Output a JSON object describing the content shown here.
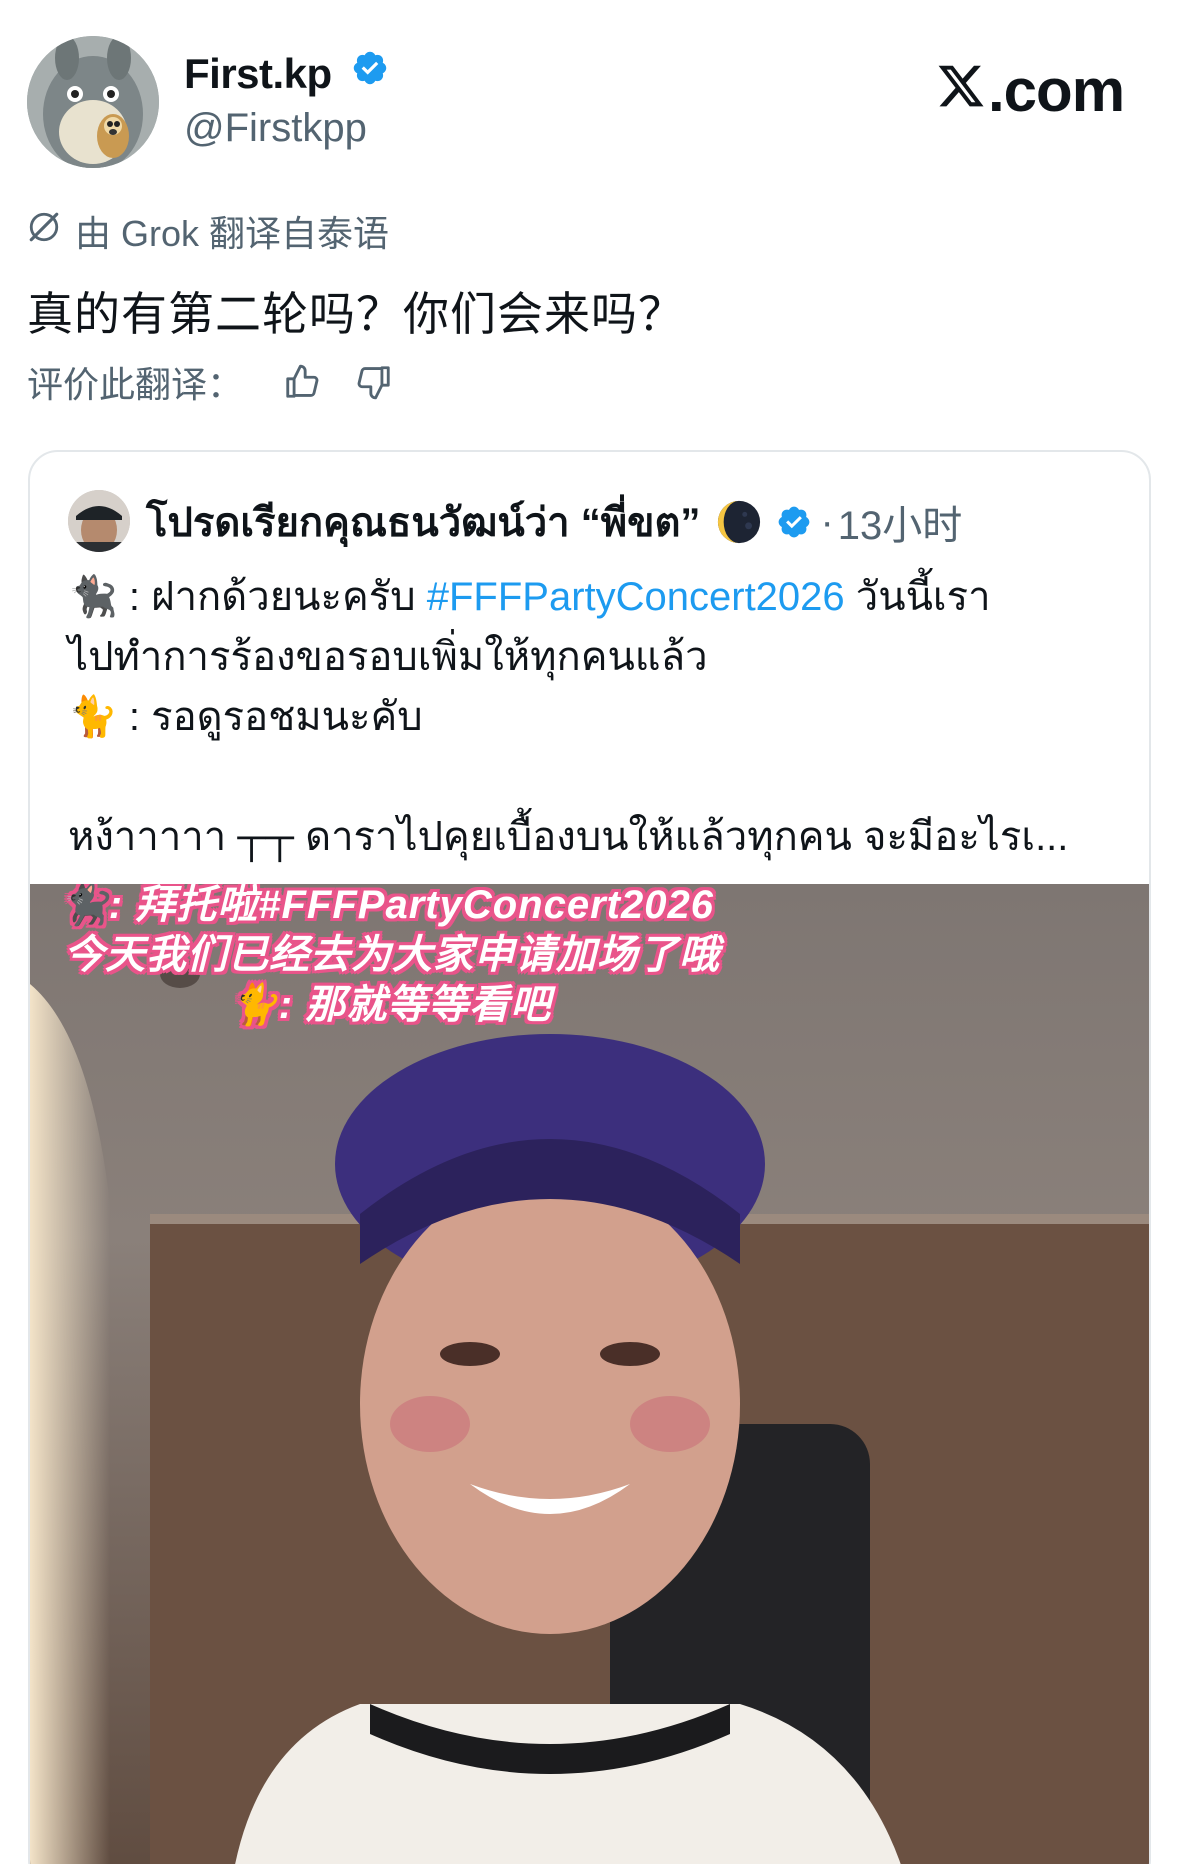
{
  "author": {
    "display_name": "First.kp",
    "handle": "@Firstkpp",
    "verified": true
  },
  "brand": {
    "site": ".com"
  },
  "translation": {
    "label": "由 Grok 翻译自泰语",
    "text": "真的有第二轮吗？你们会来吗？",
    "rate_label": "评价此翻译："
  },
  "quoted": {
    "display_name": "โปรดเรียกคุณธนวัฒน์ว่า “พี่ขต”",
    "dot": "·",
    "time": "13小时",
    "lines": [
      {
        "emoji": "🐈‍⬛",
        "text": " : ฝากด้วยนะครับ ",
        "hashtag": "#FFFPartyConcert2026",
        "after": " วันนี้เรา"
      },
      {
        "text": "ไปทำการร้องขอรอบเพิ่มให้ทุกคนแล้ว"
      },
      {
        "emoji": "🐈",
        "text": " : รอดูรอชมนะคับ"
      },
      {
        "text": "หง้าาาาา ┬┬ ดาราไปคุยเบื้องบนให้แล้วทุกคน จะมีอะไรเ..."
      }
    ],
    "media_captions": [
      "🐈‍⬛: 拜托啦#FFFPartyConcert2026",
      "今天我们已经去为大家申请加场了哦",
      "🐈: 那就等等看吧"
    ]
  },
  "colors": {
    "accent": "#1d9bf0",
    "text_primary": "#0f1419",
    "text_secondary": "#536471",
    "caption_outline": "#e9548a"
  },
  "icons": [
    "verified-badge-icon",
    "x-logo-icon",
    "grok-icon",
    "thumbs-up-icon",
    "thumbs-down-icon",
    "moon-emoji-icon"
  ]
}
